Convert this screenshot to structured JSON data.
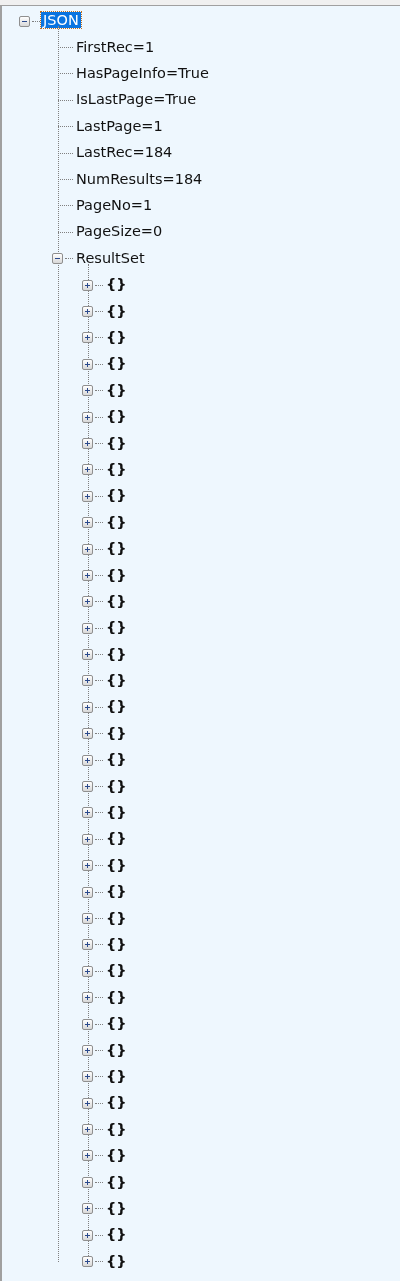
{
  "tree": {
    "label": "JSON",
    "expanded": true,
    "selected": true,
    "children": [
      {
        "label": "FirstRec=1",
        "selected": false
      },
      {
        "label": "HasPageInfo=True",
        "selected": false
      },
      {
        "label": "IsLastPage=True",
        "selected": false
      },
      {
        "label": "LastPage=1",
        "selected": false
      },
      {
        "label": "LastRec=184",
        "selected": false
      },
      {
        "label": "NumResults=184",
        "selected": false
      },
      {
        "label": "PageNo=1",
        "selected": false
      },
      {
        "label": "PageSize=0",
        "selected": false
      },
      {
        "label": "ResultSet",
        "expanded": true,
        "selected": false,
        "children": [
          {
            "label": "{}",
            "expanded": false,
            "selected": false
          },
          {
            "label": "{}",
            "expanded": false,
            "selected": false
          },
          {
            "label": "{}",
            "expanded": false,
            "selected": false
          },
          {
            "label": "{}",
            "expanded": false,
            "selected": false
          },
          {
            "label": "{}",
            "expanded": false,
            "selected": false
          },
          {
            "label": "{}",
            "expanded": false,
            "selected": false
          },
          {
            "label": "{}",
            "expanded": false,
            "selected": false
          },
          {
            "label": "{}",
            "expanded": false,
            "selected": false
          },
          {
            "label": "{}",
            "expanded": false,
            "selected": false
          },
          {
            "label": "{}",
            "expanded": false,
            "selected": false
          },
          {
            "label": "{}",
            "expanded": false,
            "selected": false
          },
          {
            "label": "{}",
            "expanded": false,
            "selected": false
          },
          {
            "label": "{}",
            "expanded": false,
            "selected": false
          },
          {
            "label": "{}",
            "expanded": false,
            "selected": false
          },
          {
            "label": "{}",
            "expanded": false,
            "selected": false
          },
          {
            "label": "{}",
            "expanded": false,
            "selected": false
          },
          {
            "label": "{}",
            "expanded": false,
            "selected": false
          },
          {
            "label": "{}",
            "expanded": false,
            "selected": false
          },
          {
            "label": "{}",
            "expanded": false,
            "selected": false
          },
          {
            "label": "{}",
            "expanded": false,
            "selected": false
          },
          {
            "label": "{}",
            "expanded": false,
            "selected": false
          },
          {
            "label": "{}",
            "expanded": false,
            "selected": false
          },
          {
            "label": "{}",
            "expanded": false,
            "selected": false
          },
          {
            "label": "{}",
            "expanded": false,
            "selected": false
          },
          {
            "label": "{}",
            "expanded": false,
            "selected": false
          },
          {
            "label": "{}",
            "expanded": false,
            "selected": false
          },
          {
            "label": "{}",
            "expanded": false,
            "selected": false
          },
          {
            "label": "{}",
            "expanded": false,
            "selected": false
          },
          {
            "label": "{}",
            "expanded": false,
            "selected": false
          },
          {
            "label": "{}",
            "expanded": false,
            "selected": false
          },
          {
            "label": "{}",
            "expanded": false,
            "selected": false
          },
          {
            "label": "{}",
            "expanded": false,
            "selected": false
          },
          {
            "label": "{}",
            "expanded": false,
            "selected": false
          },
          {
            "label": "{}",
            "expanded": false,
            "selected": false
          },
          {
            "label": "{}",
            "expanded": false,
            "selected": false
          },
          {
            "label": "{}",
            "expanded": false,
            "selected": false
          },
          {
            "label": "{}",
            "expanded": false,
            "selected": false
          },
          {
            "label": "{}",
            "expanded": false,
            "selected": false
          }
        ]
      }
    ]
  }
}
